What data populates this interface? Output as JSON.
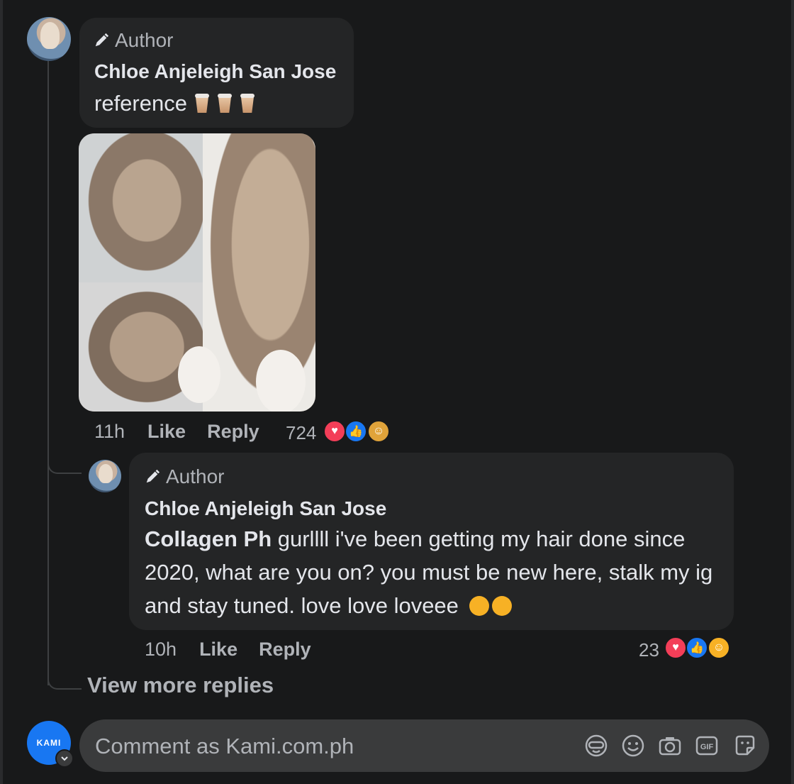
{
  "comment": {
    "author_badge": "Author",
    "author_name": "Chloe Anjeleigh San Jose",
    "text": "reference",
    "emoji": "bubble-tea x3",
    "time": "11h",
    "like_label": "Like",
    "reply_label": "Reply",
    "reaction_count": "724",
    "reactions": [
      "love",
      "like",
      "care"
    ]
  },
  "reply": {
    "author_badge": "Author",
    "author_name": "Chloe Anjeleigh San Jose",
    "mention": "Collagen Ph",
    "text": " gurllll i've been getting my hair done since 2020, what are you on? you must be new here, stalk my ig and stay tuned. love love loveee",
    "time": "10h",
    "like_label": "Like",
    "reply_label": "Reply",
    "reaction_count": "23",
    "reactions": [
      "love",
      "like",
      "haha"
    ]
  },
  "view_more_replies": "View more replies",
  "composer": {
    "avatar_text": "KAMI",
    "placeholder": "Comment as Kami.com.ph",
    "tools": [
      "avatar-sticker-icon",
      "emoji-icon",
      "camera-icon",
      "gif-icon",
      "sticker-icon"
    ]
  },
  "colors": {
    "background": "#18191a",
    "bubble": "#242526",
    "composer": "#3a3b3c",
    "text": "#e4e6eb",
    "secondary_text": "#b0b3b8",
    "love": "#f33e58",
    "like": "#1877f2"
  }
}
